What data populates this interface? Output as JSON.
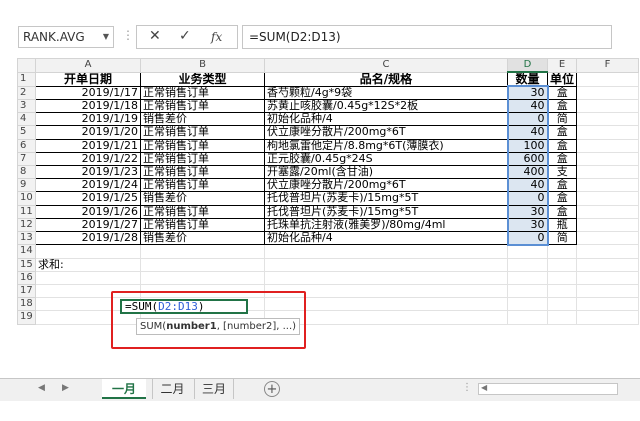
{
  "formula_bar": {
    "name_box": "RANK.AVG",
    "cancel_icon": "✕",
    "enter_icon": "✓",
    "fx_label": "fx",
    "formula": "=SUM(D2:D13)"
  },
  "columns": [
    "A",
    "B",
    "C",
    "D",
    "E",
    "F"
  ],
  "row_numbers": [
    "1",
    "2",
    "3",
    "4",
    "5",
    "6",
    "7",
    "8",
    "9",
    "10",
    "11",
    "12",
    "13",
    "14",
    "15",
    "16",
    "17",
    "18",
    "19"
  ],
  "header": [
    "开单日期",
    "业务类型",
    "品名/规格",
    "数量",
    "单位"
  ],
  "rows": [
    [
      "2019/1/17",
      "正常销售订单",
      "香芍颗粒/4g*9袋",
      "30",
      "盒"
    ],
    [
      "2019/1/18",
      "正常销售订单",
      "苏黄止咳胶囊/0.45g*12S*2板",
      "40",
      "盒"
    ],
    [
      "2019/1/19",
      "销售差价",
      "初始化品种/4",
      "0",
      "简"
    ],
    [
      "2019/1/20",
      "正常销售订单",
      "伏立康唑分散片/200mg*6T",
      "40",
      "盒"
    ],
    [
      "2019/1/21",
      "正常销售订单",
      "枸地氯雷他定片/8.8mg*6T(薄膜衣)",
      "100",
      "盒"
    ],
    [
      "2019/1/22",
      "正常销售订单",
      "正元胶囊/0.45g*24S",
      "600",
      "盒"
    ],
    [
      "2019/1/23",
      "正常销售订单",
      "开塞露/20ml(含甘油)",
      "400",
      "支"
    ],
    [
      "2019/1/24",
      "正常销售订单",
      "伏立康唑分散片/200mg*6T",
      "40",
      "盒"
    ],
    [
      "2019/1/25",
      "销售差价",
      "托伐普坦片(苏麦卡)/15mg*5T",
      "0",
      "盒"
    ],
    [
      "2019/1/26",
      "正常销售订单",
      "托伐普坦片(苏麦卡)/15mg*5T",
      "30",
      "盒"
    ],
    [
      "2019/1/27",
      "正常销售订单",
      "托珠单抗注射液(雅美罗)/80mg/4ml",
      "30",
      "瓶"
    ],
    [
      "2019/1/28",
      "销售差价",
      "初始化品种/4",
      "0",
      "简"
    ]
  ],
  "sum_label": "求和:",
  "edit_cell": {
    "prefix": "=SUM(",
    "ref": "D2:D13",
    "suffix": ")"
  },
  "tooltip": {
    "fn": "SUM(",
    "arg1": "number1",
    "rest": ", [number2], ...)"
  },
  "sheets": [
    "一月",
    "二月",
    "三月"
  ],
  "active_sheet": "一月",
  "add_sheet_icon": "+",
  "colors": {
    "accent": "#217346",
    "highlight": "#e02020",
    "ref_blue": "#2f5fd8"
  }
}
